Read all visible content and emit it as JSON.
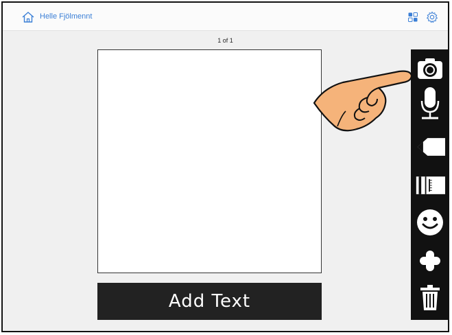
{
  "header": {
    "username": "Helle Fjölmennt"
  },
  "page": {
    "indicator": "1 of 1"
  },
  "editor": {
    "add_text_label": "Add Text"
  },
  "toolbar": {
    "tools": [
      "camera-icon",
      "microphone-icon",
      "pencil-icon",
      "ruler-icon",
      "smiley-icon",
      "plus-icon",
      "trash-icon"
    ]
  },
  "colors": {
    "accent": "#3b7fd6",
    "toolbar_bg": "#111111",
    "add_text_bg": "#222222",
    "hand_skin": "#f5b37a"
  }
}
